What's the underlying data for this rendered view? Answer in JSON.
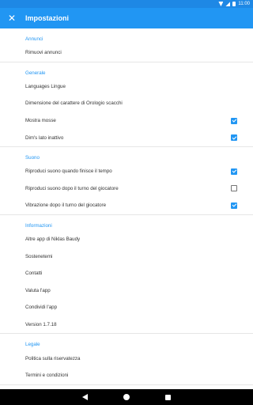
{
  "status_bar": {
    "time": "11:00"
  },
  "app_bar": {
    "title": "Impostazioni",
    "close_icon": "close-icon"
  },
  "sections": [
    {
      "header": "Annunci",
      "items": [
        {
          "label": "Rimuovi annunci"
        }
      ]
    },
    {
      "header": "Generale",
      "items": [
        {
          "label": "Languages Lingue"
        },
        {
          "label": "Dimensione del carattere di Orologio scacchi"
        },
        {
          "label": "Mostra mosse",
          "checked": true
        },
        {
          "label": "Dim's lato inattivo",
          "checked": true
        }
      ]
    },
    {
      "header": "Suono",
      "items": [
        {
          "label": "Riproduci suono quando finisce il tempo",
          "checked": true
        },
        {
          "label": "Riproduci suono dopo il turno del giocatore",
          "checked": false
        },
        {
          "label": "Vibrazione dopo il turno del giocatore",
          "checked": true
        }
      ]
    },
    {
      "header": "Informazioni",
      "items": [
        {
          "label": "Altre app di Niklas Baudy"
        },
        {
          "label": "Sostenetemi"
        },
        {
          "label": "Contatti"
        },
        {
          "label": "Valuta l'app"
        },
        {
          "label": "Condividi l'app"
        },
        {
          "label": "Version 1.7.18"
        }
      ]
    },
    {
      "header": "Legale",
      "items": [
        {
          "label": "Politica sulla riservatezza"
        },
        {
          "label": "Termini e condizioni"
        }
      ]
    }
  ],
  "colors": {
    "primary": "#2196f3",
    "status_bar": "#1e88e5",
    "nav_bar": "#000000"
  }
}
